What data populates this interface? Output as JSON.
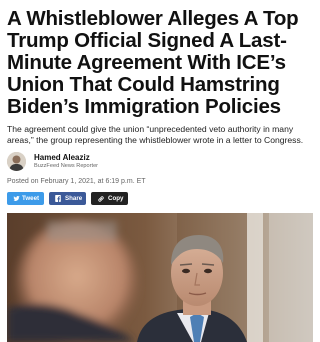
{
  "article": {
    "headline": "A Whistleblower Alleges A Top Trump Official Signed A Last-Minute Agreement With ICE’s Union That Could Hamstring Biden’s Immigration Policies",
    "dek": "The agreement could give the union “unprecedented veto authority in many areas,” the group representing the whistleblower wrote in a letter to Congress.",
    "author": {
      "name": "Hamed Aleaziz",
      "role": "BuzzFeed News Reporter"
    },
    "posted": "Posted on February 1, 2021, at 6:19 p.m. ET"
  },
  "share": {
    "twitter_label": "Tweet",
    "facebook_label": "Share",
    "copy_label": "Copy",
    "twitter_icon": "twitter-bird-icon",
    "facebook_icon": "facebook-f-icon",
    "copy_icon": "link-icon",
    "twitter_color": "#3d9be9",
    "facebook_color": "#3b5998",
    "copy_color": "#222222"
  },
  "hero_image": {
    "subject": "photo of officials at a hearing"
  }
}
